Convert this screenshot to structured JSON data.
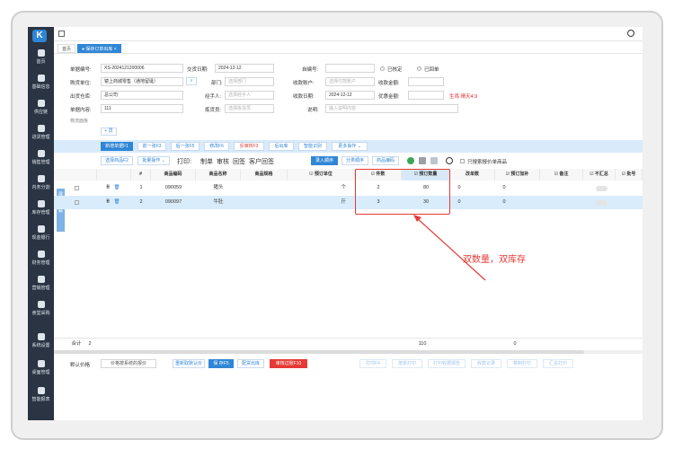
{
  "sidebar": {
    "logo": "K",
    "items": [
      {
        "label": "首页"
      },
      {
        "label": "基础信息"
      },
      {
        "label": "供应链"
      },
      {
        "label": "进货管理"
      },
      {
        "label": "销售管理"
      },
      {
        "label": "内务分割"
      },
      {
        "label": "库存管理"
      },
      {
        "label": "现金银行"
      },
      {
        "label": "财务管理"
      },
      {
        "label": "营销管理"
      },
      {
        "label": "食堂采购"
      },
      {
        "label": "系统设置"
      },
      {
        "label": "桌面管理"
      },
      {
        "label": "智能报表"
      }
    ]
  },
  "tabs": [
    {
      "label": "首页"
    },
    {
      "label": "● 保存订单出库 ×"
    }
  ],
  "form": {
    "order_no_label": "单据编号:",
    "order_no_value": "XS-2024121200006",
    "trade_date_label": "交货日期:",
    "trade_date_value": "2024-12-12",
    "order_no2_label": "自编号:",
    "checked_label": "已核定",
    "returned_label": "已回单",
    "buyer_label": "购货单位:",
    "buyer_value": "镜上商城零售（通地留诞）",
    "dept_label": "部门:",
    "dept_placeholder": "选择部门",
    "receipt_acct_label": "收款账户:",
    "receipt_acct_placeholder": "选择付款账户",
    "receipt_amount_label": "收款金额:",
    "warehouse_label": "出货仓库:",
    "warehouse_value": "总公司",
    "handler_label": "经手人:",
    "handler_placeholder": "选择经手人",
    "receipt_date_label": "收款日期:",
    "receipt_date_value": "2024-12-12",
    "discount_label": "优惠金额:",
    "weather_note": "生鸡 晴天4.9",
    "content_label": "单据内容:",
    "content_value": "111",
    "picker_label": "拣货员:",
    "picker_placeholder": "选择拣货员",
    "note_label": "说明:",
    "note_placeholder": "输入说明内容",
    "logistics_label": "物流面板",
    "add_btn": "+ 员"
  },
  "toolbar1": {
    "new": "新增单据F1",
    "prev": "前一张F3",
    "next": "后一张F5",
    "edit": "修改F6",
    "reverse": "反审核F3",
    "print": "后出库",
    "smart": "智能识别",
    "more": "更多操作 ⌄"
  },
  "toolbar2": {
    "select_product": "选择商品F2",
    "batch": "批量操作 ⌄",
    "print_text": "打印:",
    "make": "制单",
    "audit": "审核",
    "return": "回签",
    "customer_return": "客户回签",
    "record_order": "录入顺序",
    "category_order": "分类顺序",
    "product_code": "商品编码",
    "only_quote": "只搜索报价单商品"
  },
  "grid": {
    "side_tab": "展开 隐藏",
    "headers": [
      "#",
      "商品编码",
      "商品名称",
      "商品规格",
      "☑ 预订单位",
      "☑ 件数",
      "☑ 预订数量",
      "改单数",
      "☑ 预订加补",
      "☑ 备注",
      "☑ 不汇总",
      "☑ 批号"
    ],
    "rows": [
      {
        "no": "1",
        "code": "090059",
        "name": "猪头",
        "spec": "",
        "unit": "个",
        "pieces": "2",
        "qty": "80",
        "change": "0",
        "extra": "0"
      },
      {
        "no": "2",
        "code": "090097",
        "name": "牛肚",
        "spec": "",
        "unit": "斤",
        "pieces": "3",
        "qty": "30",
        "change": "0",
        "extra": "0"
      }
    ]
  },
  "annotation": "双数量，双库存",
  "summary": {
    "label": "合计",
    "count": "2",
    "qty_total": "110",
    "extra_total": "0"
  },
  "footer": {
    "default_price_label": "默认价格",
    "default_price_value": "价格按系统的报价",
    "reload": "重新取默认价",
    "save": "保 存F5",
    "delivery": "配货出库",
    "audit_save": "审核过账F10",
    "print": "打印F4",
    "print_preview": "按单打印",
    "print_by_type": "打印收据报告",
    "view_record": "收款记录",
    "copy": "复制打印",
    "summary_print": "汇总打印"
  },
  "colors": {
    "accent": "#2f86d6",
    "sidebar": "#2a3443",
    "highlight": "#e53935",
    "selected_row": "#d9ecfb"
  }
}
